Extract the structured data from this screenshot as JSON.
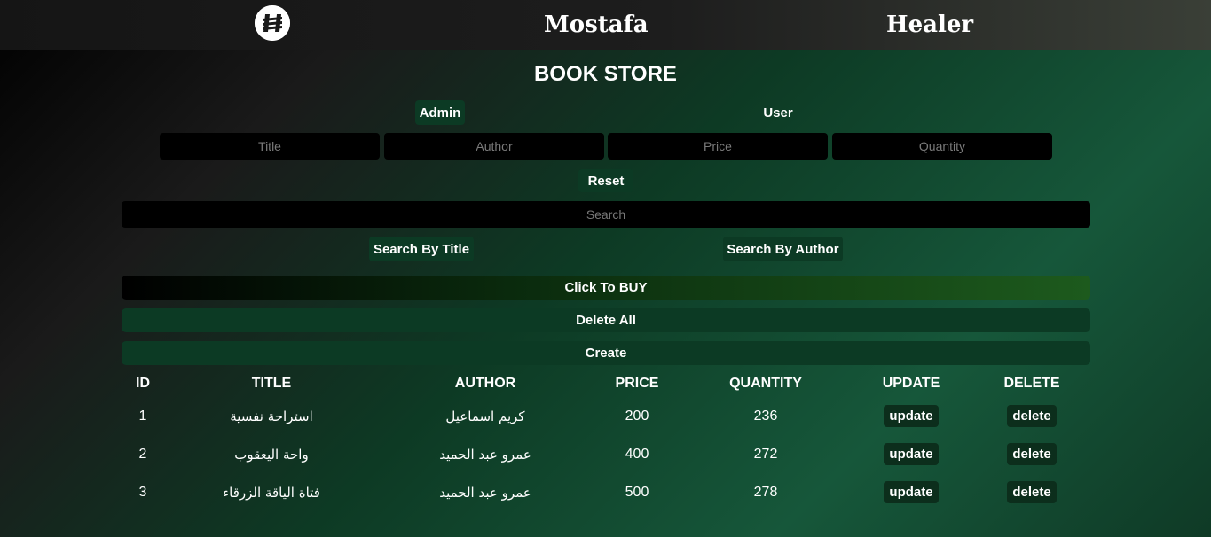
{
  "header": {
    "logo_icon": "h-logo-icon",
    "brand_first": "Mostafa",
    "brand_second": "Healer"
  },
  "store": {
    "title": "BOOK STORE",
    "mode_admin": "Admin",
    "mode_user": "User",
    "placeholders": {
      "title": "Title",
      "author": "Author",
      "price": "Price",
      "quantity": "Quantity",
      "search": "Search"
    },
    "reset_label": "Reset",
    "search_by_title_label": "Search By Title",
    "search_by_author_label": "Search By Author",
    "buy_label": "Click To BUY",
    "delete_all_label": "Delete All",
    "create_label": "Create"
  },
  "table": {
    "headers": {
      "id": "ID",
      "title": "TITLE",
      "author": "AUTHOR",
      "price": "PRICE",
      "quantity": "QUANTITY",
      "update": "UPDATE",
      "delete": "DELETE"
    },
    "rows": [
      {
        "id": "1",
        "title": "استراحة نفسية",
        "author": "كريم اسماعيل",
        "price": "200",
        "quantity": "236",
        "update": "update",
        "delete": "delete"
      },
      {
        "id": "2",
        "title": "واحة اليعقوب",
        "author": "عمرو عبد الحميد",
        "price": "400",
        "quantity": "272",
        "update": "update",
        "delete": "delete"
      },
      {
        "id": "3",
        "title": "فتاة الياقة الزرقاء",
        "author": "عمرو عبد الحميد",
        "price": "500",
        "quantity": "278",
        "update": "update",
        "delete": "delete"
      }
    ]
  },
  "colors": {
    "accent_dark_green": "#0c3a24",
    "buy_gradient_end": "#1d5a1d"
  }
}
